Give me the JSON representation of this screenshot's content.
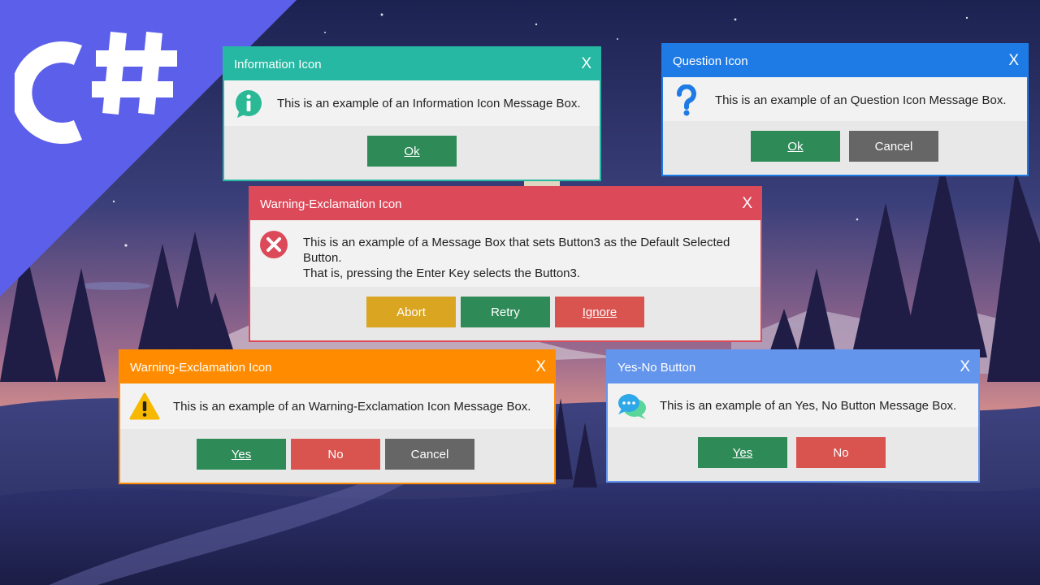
{
  "brand": {
    "logo_text": "C#",
    "corner_color": "#5b5fea"
  },
  "dialogs": {
    "info": {
      "title": "Information Icon",
      "close": "X",
      "message": "This is an example of an Information Icon Message Box.",
      "buttons": [
        "Ok"
      ],
      "accent": "#26b8a2",
      "icon": "info-icon"
    },
    "question": {
      "title": "Question Icon",
      "close": "X",
      "message": "This is an example of an Question Icon Message Box.",
      "buttons": [
        "Ok",
        "Cancel"
      ],
      "accent": "#1e7be6",
      "icon": "question-icon"
    },
    "error": {
      "title": "Warning-Exclamation Icon",
      "close": "X",
      "message_lines": [
        "This is an example of a Message Box that sets Button3 as the Default Selected",
        "Button.",
        "That is, pressing the Enter Key selects the Button3."
      ],
      "buttons": [
        "Abort",
        "Retry",
        "Ignore"
      ],
      "accent": "#dc4a5a",
      "icon": "error-icon"
    },
    "warning": {
      "title": "Warning-Exclamation Icon",
      "close": "X",
      "message": "This is an example of an Warning-Exclamation Icon Message Box.",
      "buttons": [
        "Yes",
        "No",
        "Cancel"
      ],
      "accent": "#ff8c00",
      "icon": "warning-icon"
    },
    "yesno": {
      "title": "Yes-No Button",
      "close": "X",
      "message": "This is an example of an Yes, No Button Message Box.",
      "buttons": [
        "Yes",
        "No"
      ],
      "accent": "#6495ed",
      "icon": "chat-icon"
    }
  }
}
